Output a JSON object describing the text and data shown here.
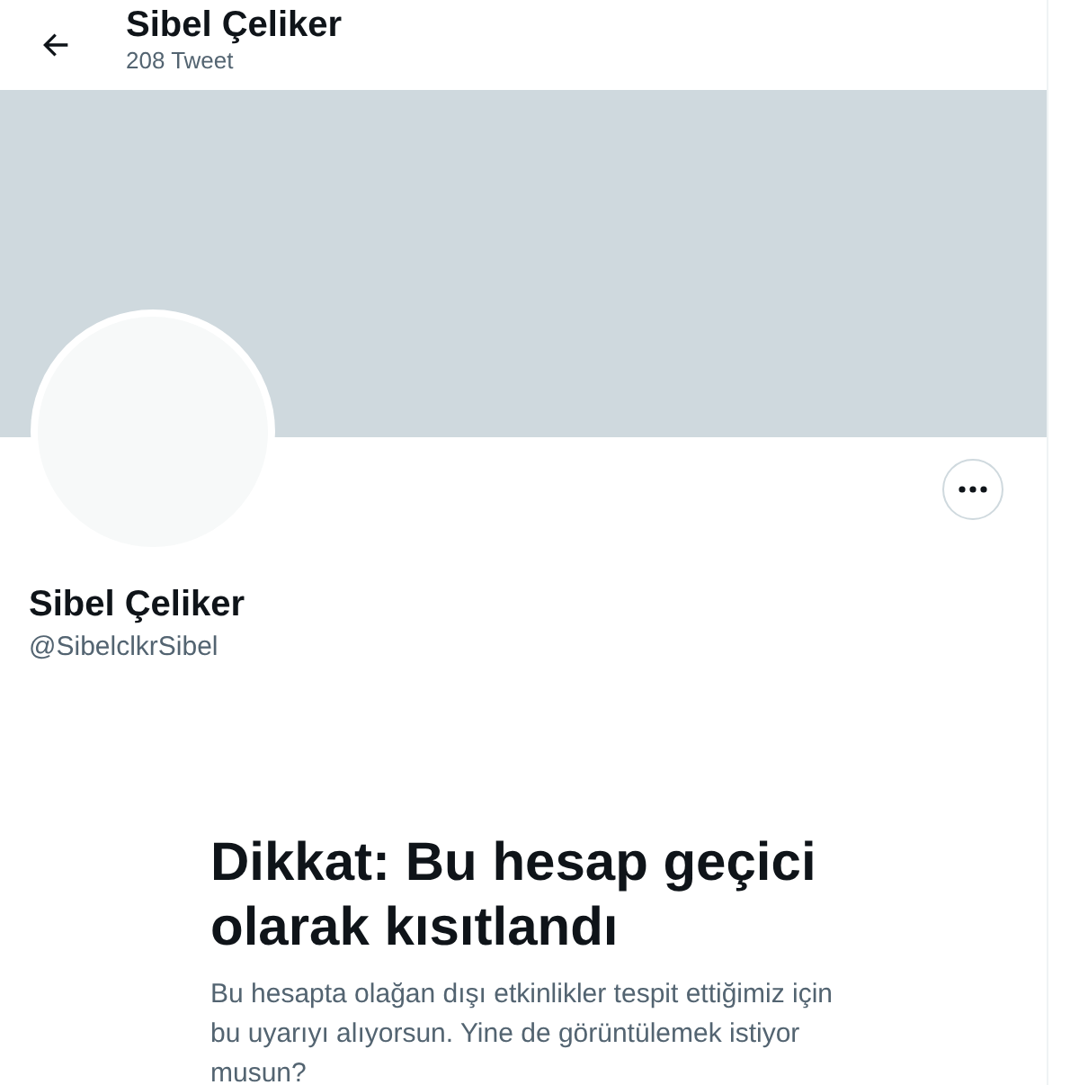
{
  "header": {
    "name": "Sibel Çeliker",
    "tweet_count": "208 Tweet"
  },
  "profile": {
    "name": "Sibel Çeliker",
    "handle": "@SibelclkrSibel"
  },
  "warning": {
    "title": "Dikkat: Bu hesap geçici olarak kısıtlandı",
    "body": "Bu hesapta olağan dışı etkinlikler tespit ettiğimiz için bu uyarıyı alıyorsun. Yine de görüntülemek istiyor musun?"
  }
}
